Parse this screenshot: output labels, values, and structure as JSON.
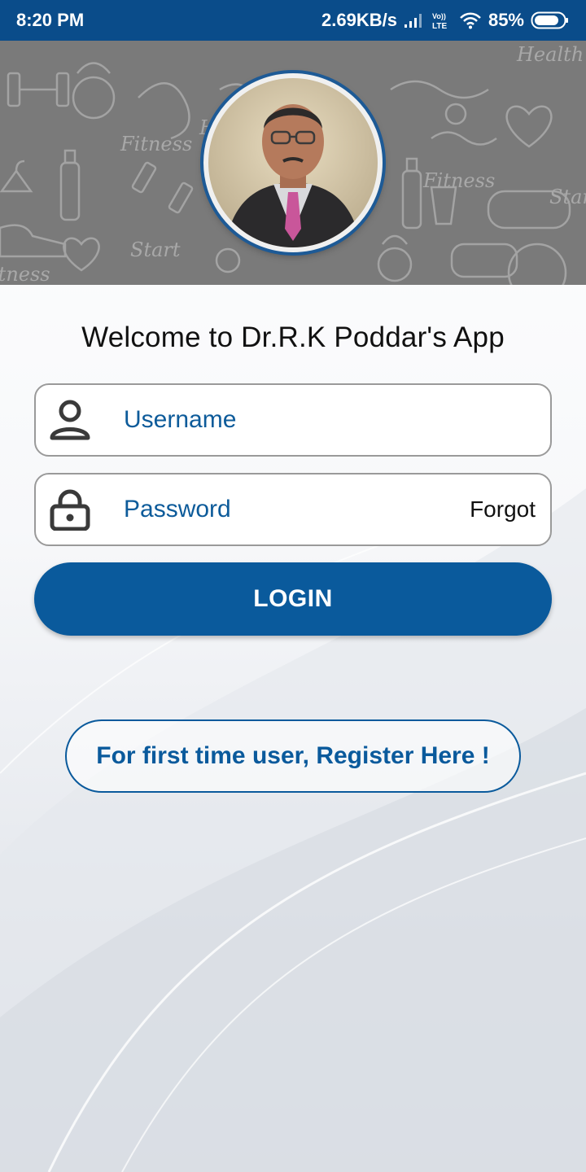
{
  "status_bar": {
    "time": "8:20 PM",
    "net_speed": "2.69KB/s",
    "volte": "Vo)) LTE",
    "battery": "85%",
    "icons": [
      "signal-icon",
      "volte-icon",
      "wifi-icon",
      "battery-icon"
    ]
  },
  "header": {
    "pattern_words": [
      "Fitness",
      "Health",
      "Start",
      "Fitness",
      "Start",
      "Health",
      "Fitness"
    ],
    "avatar_alt": "profile-photo"
  },
  "welcome_title": "Welcome to Dr.R.K Poddar's App",
  "username": {
    "placeholder": "Username",
    "value": "",
    "icon": "user-icon"
  },
  "password": {
    "placeholder": "Password",
    "value": "",
    "icon": "lock-icon",
    "forgot_label": "Forgot"
  },
  "login_label": "LOGIN",
  "register_label": "For first time user, Register Here !",
  "colors": {
    "status_bar": "#0a4c8a",
    "primary": "#0a5a9c",
    "header_bg": "#7a7a7a"
  }
}
